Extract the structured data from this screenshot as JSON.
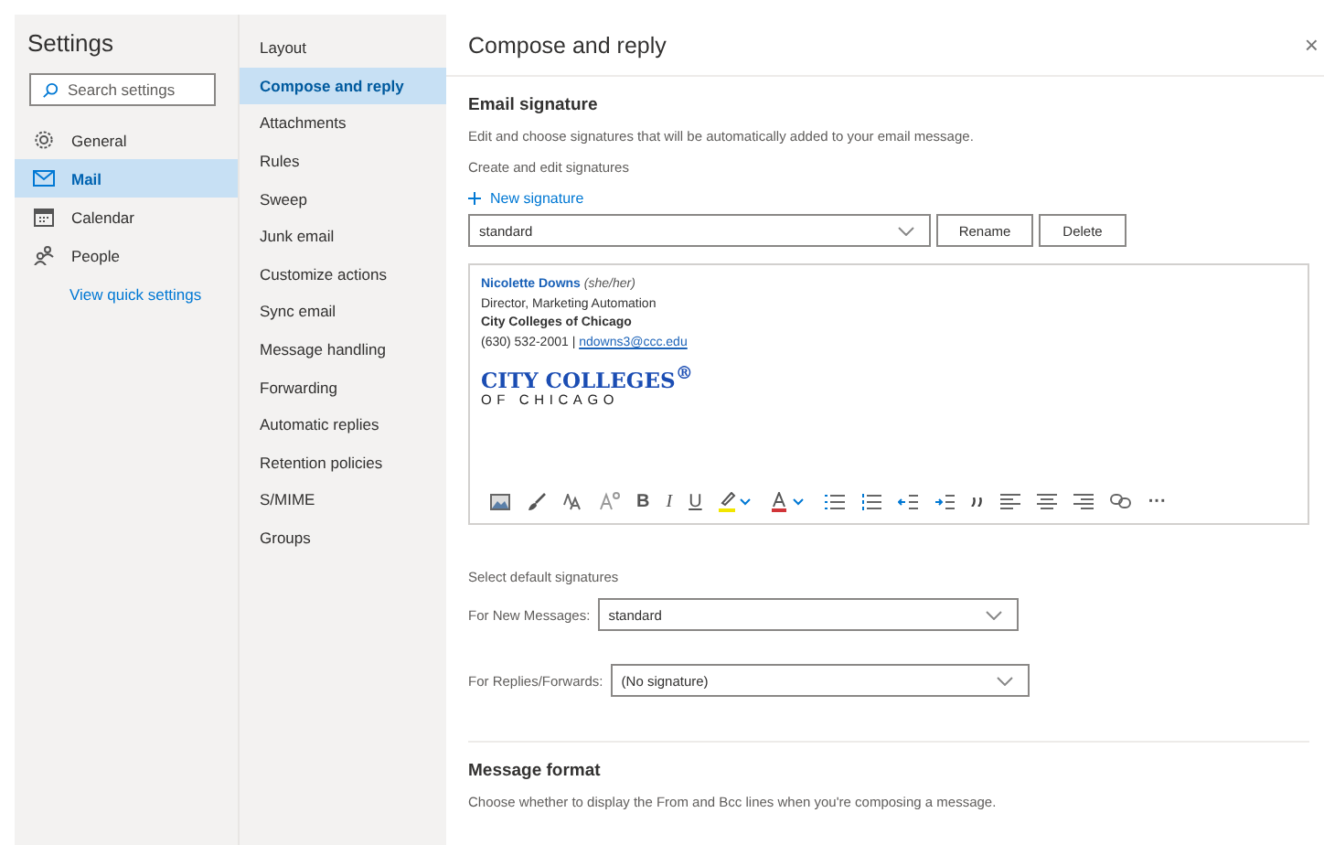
{
  "settings": {
    "title": "Settings",
    "search": {
      "placeholder": "Search settings"
    },
    "items": [
      {
        "label": "General",
        "kind": "gear",
        "selected": false
      },
      {
        "label": "Mail",
        "kind": "mail",
        "selected": true
      },
      {
        "label": "Calendar",
        "kind": "calendar",
        "selected": false
      },
      {
        "label": "People",
        "kind": "people",
        "selected": false
      }
    ],
    "quick_link": "View quick settings"
  },
  "subnav": [
    {
      "label": "Layout",
      "selected": false
    },
    {
      "label": "Compose and reply",
      "selected": true
    },
    {
      "label": "Attachments",
      "selected": false
    },
    {
      "label": "Rules",
      "selected": false
    },
    {
      "label": "Sweep",
      "selected": false
    },
    {
      "label": "Junk email",
      "selected": false
    },
    {
      "label": "Customize actions",
      "selected": false
    },
    {
      "label": "Sync email",
      "selected": false
    },
    {
      "label": "Message handling",
      "selected": false
    },
    {
      "label": "Forwarding",
      "selected": false
    },
    {
      "label": "Automatic replies",
      "selected": false
    },
    {
      "label": "Retention policies",
      "selected": false
    },
    {
      "label": "S/MIME",
      "selected": false
    },
    {
      "label": "Groups",
      "selected": false
    }
  ],
  "panel": {
    "title": "Compose and reply",
    "close": "×",
    "signature": {
      "heading": "Email signature",
      "description": "Edit and choose signatures that will be automatically added to your email message.",
      "subheading": "Create and edit signatures",
      "new_link": "New signature",
      "selected_signature": "standard",
      "buttons": [
        "Rename",
        "Delete"
      ],
      "body": {
        "name": "Nicolette Downs",
        "pronouns": "(she/her)",
        "title": "Director, Marketing Automation",
        "organization": "City Colleges of Chicago",
        "phone": "(630) 532-2001 |",
        "email": "ndowns3@ccc.edu",
        "logo_line1": "CITY COLLEGES$^{®}$",
        "logo_line2": "OF CHICAGO"
      },
      "toolbar": [
        {
          "kind": "image"
        },
        {
          "kind": "brush"
        },
        {
          "kind": "fontsize"
        },
        {
          "kind": "superscript"
        },
        {
          "kind": "bold",
          "text": "B"
        },
        {
          "kind": "italic",
          "text": "I"
        },
        {
          "kind": "underline",
          "text": "U"
        },
        {
          "kind": "highlight"
        },
        {
          "kind": "fontcolor"
        },
        {
          "kind": "bullets"
        },
        {
          "kind": "numbering"
        },
        {
          "kind": "outdent"
        },
        {
          "kind": "indent"
        },
        {
          "kind": "quote"
        },
        {
          "kind": "alignleft"
        },
        {
          "kind": "aligncenter"
        },
        {
          "kind": "alignright"
        },
        {
          "kind": "link"
        },
        {
          "kind": "more",
          "text": "···"
        }
      ]
    },
    "defaults": {
      "heading": "Select default signatures",
      "rows": [
        {
          "label": "For New Messages:",
          "value": "standard"
        },
        {
          "label": "For Replies/Forwards:",
          "value": "(No signature)"
        }
      ]
    },
    "format": {
      "heading": "Message format",
      "description": "Choose whether to display the From and Bcc lines when you're composing a message."
    }
  }
}
